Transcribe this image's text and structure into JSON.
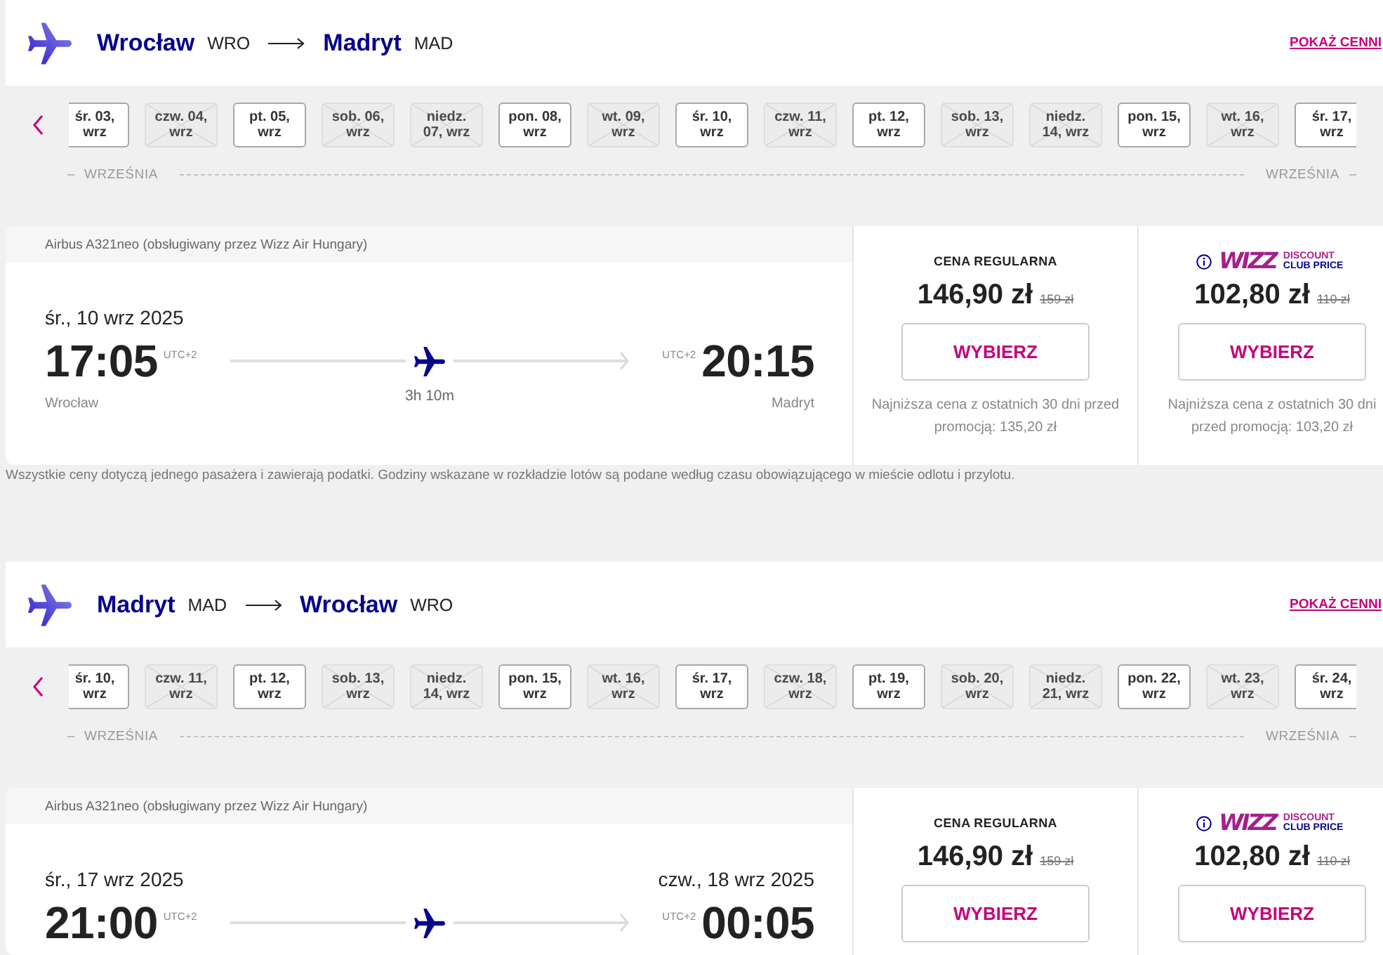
{
  "sections": [
    {
      "header": {
        "origin_city": "Wrocław",
        "origin_code": "WRO",
        "destination_city": "Madryt",
        "destination_code": "MAD",
        "link": "POKAŻ CENNI"
      },
      "dates": [
        {
          "lines": [
            "śr. 03,",
            "wrz"
          ],
          "available": true
        },
        {
          "lines": [
            "czw. 04,",
            "wrz"
          ],
          "available": false
        },
        {
          "lines": [
            "pt. 05,",
            "wrz"
          ],
          "available": true
        },
        {
          "lines": [
            "sob. 06,",
            "wrz"
          ],
          "available": false
        },
        {
          "lines": [
            "niedz.",
            "07, wrz"
          ],
          "available": false
        },
        {
          "lines": [
            "pon. 08,",
            "wrz"
          ],
          "available": true
        },
        {
          "lines": [
            "wt. 09,",
            "wrz"
          ],
          "available": false
        },
        {
          "lines": [
            "śr. 10,",
            "wrz"
          ],
          "available": true
        },
        {
          "lines": [
            "czw. 11,",
            "wrz"
          ],
          "available": false
        },
        {
          "lines": [
            "pt. 12,",
            "wrz"
          ],
          "available": true
        },
        {
          "lines": [
            "sob. 13,",
            "wrz"
          ],
          "available": false
        },
        {
          "lines": [
            "niedz.",
            "14, wrz"
          ],
          "available": false
        },
        {
          "lines": [
            "pon. 15,",
            "wrz"
          ],
          "available": true
        },
        {
          "lines": [
            "wt. 16,",
            "wrz"
          ],
          "available": false
        },
        {
          "lines": [
            "śr. 17,",
            "wrz"
          ],
          "available": true
        }
      ],
      "month_labels": [
        "WRZEŚNIA",
        "WRZEŚNIA"
      ],
      "flight": {
        "aircraft": "Airbus A321neo (obsługiwany przez Wizz Air Hungary)",
        "departure_date": "śr., 10 wrz 2025",
        "departure_time": "17:05",
        "departure_utc": "UTC+2",
        "arrival_utc": "UTC+2",
        "arrival_time": "20:15",
        "departure_city": "Wrocław",
        "duration": "3h 10m",
        "arrival_city": "Madryt"
      },
      "fares": [
        {
          "kind": "regular",
          "label": "CENA REGULARNA",
          "price": "146,90 zł",
          "old_price": "159 zł",
          "button": "WYBIERZ",
          "note": "Najniższa cena z ostatnich 30 dni przed promocją: 135,20 zł"
        },
        {
          "kind": "club",
          "logo": {
            "wordmark": "WIZZ",
            "text": "DISCOUNT CLUB PRICE"
          },
          "price": "102,80 zł",
          "old_price": "110 zł",
          "button": "WYBIERZ",
          "note": "Najniższa cena z ostatnich 30 dni przed promocją: 103,20 zł"
        }
      ],
      "footnote": "Wszystkie ceny dotyczą jednego pasażera i zawierają podatki. Godziny wskazane w rozkładzie lotów są podane według czasu obowiązującego w mieście odlotu i przylotu."
    },
    {
      "header": {
        "origin_city": "Madryt",
        "origin_code": "MAD",
        "destination_city": "Wrocław",
        "destination_code": "WRO",
        "link": "POKAŻ CENNI"
      },
      "dates": [
        {
          "lines": [
            "śr. 10,",
            "wrz"
          ],
          "available": true
        },
        {
          "lines": [
            "czw. 11,",
            "wrz"
          ],
          "available": false
        },
        {
          "lines": [
            "pt. 12,",
            "wrz"
          ],
          "available": true
        },
        {
          "lines": [
            "sob. 13,",
            "wrz"
          ],
          "available": false
        },
        {
          "lines": [
            "niedz.",
            "14, wrz"
          ],
          "available": false
        },
        {
          "lines": [
            "pon. 15,",
            "wrz"
          ],
          "available": true
        },
        {
          "lines": [
            "wt. 16,",
            "wrz"
          ],
          "available": false
        },
        {
          "lines": [
            "śr. 17,",
            "wrz"
          ],
          "available": true
        },
        {
          "lines": [
            "czw. 18,",
            "wrz"
          ],
          "available": false
        },
        {
          "lines": [
            "pt. 19,",
            "wrz"
          ],
          "available": true
        },
        {
          "lines": [
            "sob. 20,",
            "wrz"
          ],
          "available": false
        },
        {
          "lines": [
            "niedz.",
            "21, wrz"
          ],
          "available": false
        },
        {
          "lines": [
            "pon. 22,",
            "wrz"
          ],
          "available": true
        },
        {
          "lines": [
            "wt. 23,",
            "wrz"
          ],
          "available": false
        },
        {
          "lines": [
            "śr. 24,",
            "wrz"
          ],
          "available": true
        }
      ],
      "month_labels": [
        "WRZEŚNIA",
        "WRZEŚNIA"
      ],
      "flight": {
        "aircraft": "Airbus A321neo (obsługiwany przez Wizz Air Hungary)",
        "departure_date": "śr., 17 wrz 2025",
        "arrival_date": "czw., 18 wrz 2025",
        "departure_time": "21:00",
        "departure_utc": "UTC+2",
        "arrival_utc": "UTC+2",
        "arrival_time": "00:05"
      },
      "fares": [
        {
          "kind": "regular",
          "label": "CENA REGULARNA",
          "price": "146,90 zł",
          "old_price": "159 zł",
          "button": "WYBIERZ"
        },
        {
          "kind": "club",
          "logo": {
            "wordmark": "WIZZ",
            "text": "DISCOUNT CLUB PRICE"
          },
          "price": "102,80 zł",
          "old_price": "110 zł",
          "button": "WYBIERZ"
        }
      ]
    }
  ]
}
